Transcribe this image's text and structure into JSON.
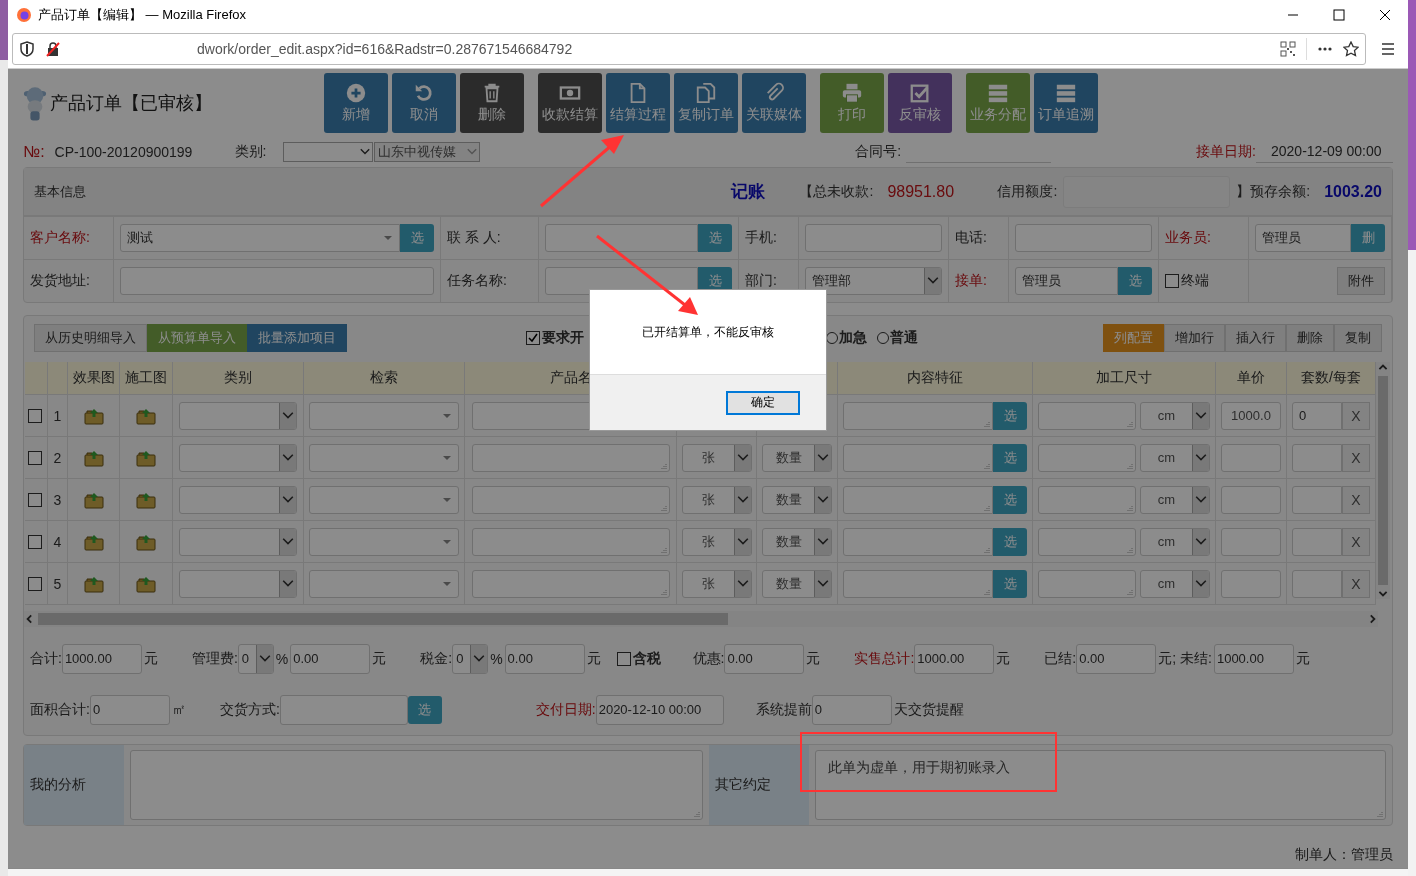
{
  "window": {
    "title": "产品订单【编辑】 — Mozilla Firefox"
  },
  "address_bar": {
    "url": "dwork/order_edit.aspx?id=616&Radstr=0.287671546684792"
  },
  "page": {
    "title": "产品订单【已审核】"
  },
  "toolbar_groups": [
    [
      {
        "label": "新增",
        "kind": "primary"
      },
      {
        "label": "取消",
        "kind": "primary"
      },
      {
        "label": "删除",
        "kind": "default"
      }
    ],
    [
      {
        "label": "收款结算",
        "kind": "default"
      },
      {
        "label": "结算过程",
        "kind": "primary"
      },
      {
        "label": "复制订单",
        "kind": "primary"
      },
      {
        "label": "关联媒体",
        "kind": "primary"
      }
    ],
    [
      {
        "label": "打印",
        "kind": "success"
      },
      {
        "label": "反审核",
        "kind": "special"
      }
    ],
    [
      {
        "label": "业务分配",
        "kind": "success"
      },
      {
        "label": "订单追溯",
        "kind": "primary"
      }
    ]
  ],
  "order_info": {
    "number_label": "№:",
    "number": "CP-100-20120900199",
    "category_label": "类别:",
    "company": "山东中视传媒",
    "contract_label": "合同号:",
    "date_label": "接单日期:",
    "date": "2020-12-09 00:00"
  },
  "basic_info": {
    "title": "基本信息",
    "bookkeeping": "记账",
    "unpaid_label": "【总未收款:",
    "unpaid": "98951.80",
    "credit_label": "信用额度:",
    "balance_label": "】预存余额:",
    "balance": "1003.20"
  },
  "form_rows": [
    [
      {
        "label": "客户名称:",
        "required": true,
        "kind": "select",
        "value": "测试",
        "button": "选"
      },
      {
        "label": "联 系 人:",
        "required": false,
        "kind": "input",
        "button": "选"
      },
      {
        "label": "手机:",
        "required": false,
        "kind": "input"
      },
      {
        "label": "电话:",
        "required": false,
        "kind": "input"
      },
      {
        "label": "业务员:",
        "required": true,
        "kind": "input",
        "value": "管理员",
        "button": "删"
      }
    ],
    [
      {
        "label": "发货地址:",
        "required": false,
        "kind": "input"
      },
      {
        "label": "任务名称:",
        "required": false,
        "kind": "input",
        "button": "选"
      },
      {
        "label": "部门:",
        "required": false,
        "kind": "dropdown",
        "value": "管理部"
      },
      {
        "label": "接单:",
        "required": true,
        "kind": "input",
        "value": "管理员",
        "button": "选"
      },
      {
        "label": "终端",
        "kind": "checkbox",
        "checked": false,
        "button": "附件"
      }
    ]
  ],
  "import_buttons": [
    {
      "label": "从历史明细导入",
      "kind": "default"
    },
    {
      "label": "从预算单导入",
      "kind": "success"
    },
    {
      "label": "批量添加项目",
      "kind": "primary"
    }
  ],
  "options": [
    {
      "label": "要求开",
      "kind": "checkbox",
      "checked": true
    },
    {
      "label": "加急",
      "kind": "radio",
      "selected": false
    },
    {
      "label": "普通",
      "kind": "radio",
      "selected": false
    }
  ],
  "row_buttons": [
    {
      "label": "列配置",
      "kind": "warning"
    },
    {
      "label": "增加行",
      "kind": "default"
    },
    {
      "label": "插入行",
      "kind": "default"
    },
    {
      "label": "删除",
      "kind": "default"
    },
    {
      "label": "复制",
      "kind": "default"
    }
  ],
  "table": {
    "columns": [
      "效果图",
      "施工图",
      "类别",
      "检索",
      "产品名",
      "内容特征",
      "加工尺寸",
      "单价",
      "套数/每套"
    ],
    "rows": [
      {
        "checked": false,
        "number": "1",
        "pick": "选",
        "size_unit": "cm",
        "price": "1000.0",
        "sets": "0",
        "remove": "X"
      },
      {
        "checked": false,
        "number": "2",
        "unit": "张",
        "measure": "数量",
        "pick": "选",
        "size_unit": "cm",
        "remove": "X"
      },
      {
        "checked": false,
        "number": "3",
        "unit": "张",
        "measure": "数量",
        "pick": "选",
        "size_unit": "cm",
        "remove": "X"
      },
      {
        "checked": false,
        "number": "4",
        "unit": "张",
        "measure": "数量",
        "pick": "选",
        "size_unit": "cm",
        "remove": "X"
      },
      {
        "checked": false,
        "number": "5",
        "unit": "张",
        "measure": "数量",
        "pick": "选",
        "size_unit": "cm",
        "remove": "X"
      }
    ]
  },
  "totals": [
    [
      {
        "kind": "label",
        "text": "合计:"
      },
      {
        "kind": "field",
        "value": "1000.00"
      },
      {
        "kind": "unit",
        "text": "元"
      },
      {
        "kind": "label",
        "text": "管理费:"
      },
      {
        "kind": "select",
        "value": "0"
      },
      {
        "kind": "unit",
        "text": "%"
      },
      {
        "kind": "field",
        "value": "0.00"
      },
      {
        "kind": "unit",
        "text": "元"
      },
      {
        "kind": "label",
        "text": "税金:"
      },
      {
        "kind": "select",
        "value": "0"
      },
      {
        "kind": "unit",
        "text": "%"
      },
      {
        "kind": "field",
        "value": "0.00"
      },
      {
        "kind": "unit",
        "text": "元"
      },
      {
        "kind": "checkbox",
        "text": "含税",
        "checked": false
      },
      {
        "kind": "label",
        "text": "优惠:"
      },
      {
        "kind": "field",
        "value": "0.00"
      },
      {
        "kind": "unit",
        "text": "元"
      },
      {
        "kind": "label",
        "text": "实售总计:",
        "required": true
      },
      {
        "kind": "field",
        "value": "1000.00"
      },
      {
        "kind": "unit",
        "text": "元"
      },
      {
        "kind": "label",
        "text": "已结:"
      },
      {
        "kind": "field",
        "value": "0.00"
      },
      {
        "kind": "unit",
        "text": "元; 未结:"
      },
      {
        "kind": "field",
        "value": "1000.00"
      },
      {
        "kind": "unit",
        "text": "元"
      }
    ],
    [
      {
        "kind": "label",
        "text": "面积合计:"
      },
      {
        "kind": "field",
        "value": "0"
      },
      {
        "kind": "unit",
        "text": "㎡"
      },
      {
        "kind": "label",
        "text": "交货方式:"
      },
      {
        "kind": "field"
      },
      {
        "kind": "button",
        "text": "选"
      },
      {
        "kind": "label",
        "text": "交付日期:",
        "required": true
      },
      {
        "kind": "field",
        "value": "2020-12-10 00:00"
      },
      {
        "kind": "label",
        "text": "系统提前"
      },
      {
        "kind": "field",
        "value": "0"
      },
      {
        "kind": "unit",
        "text": "天交货提醒"
      }
    ]
  ],
  "notes": [
    {
      "label": "我的分析"
    },
    {
      "label": "其它约定",
      "value": "此单为虚单，用于期初账录入"
    }
  ],
  "footer": {
    "creator": "制单人：管理员"
  },
  "dialog": {
    "message": "已开结算单，不能反审核",
    "button": "确定"
  }
}
